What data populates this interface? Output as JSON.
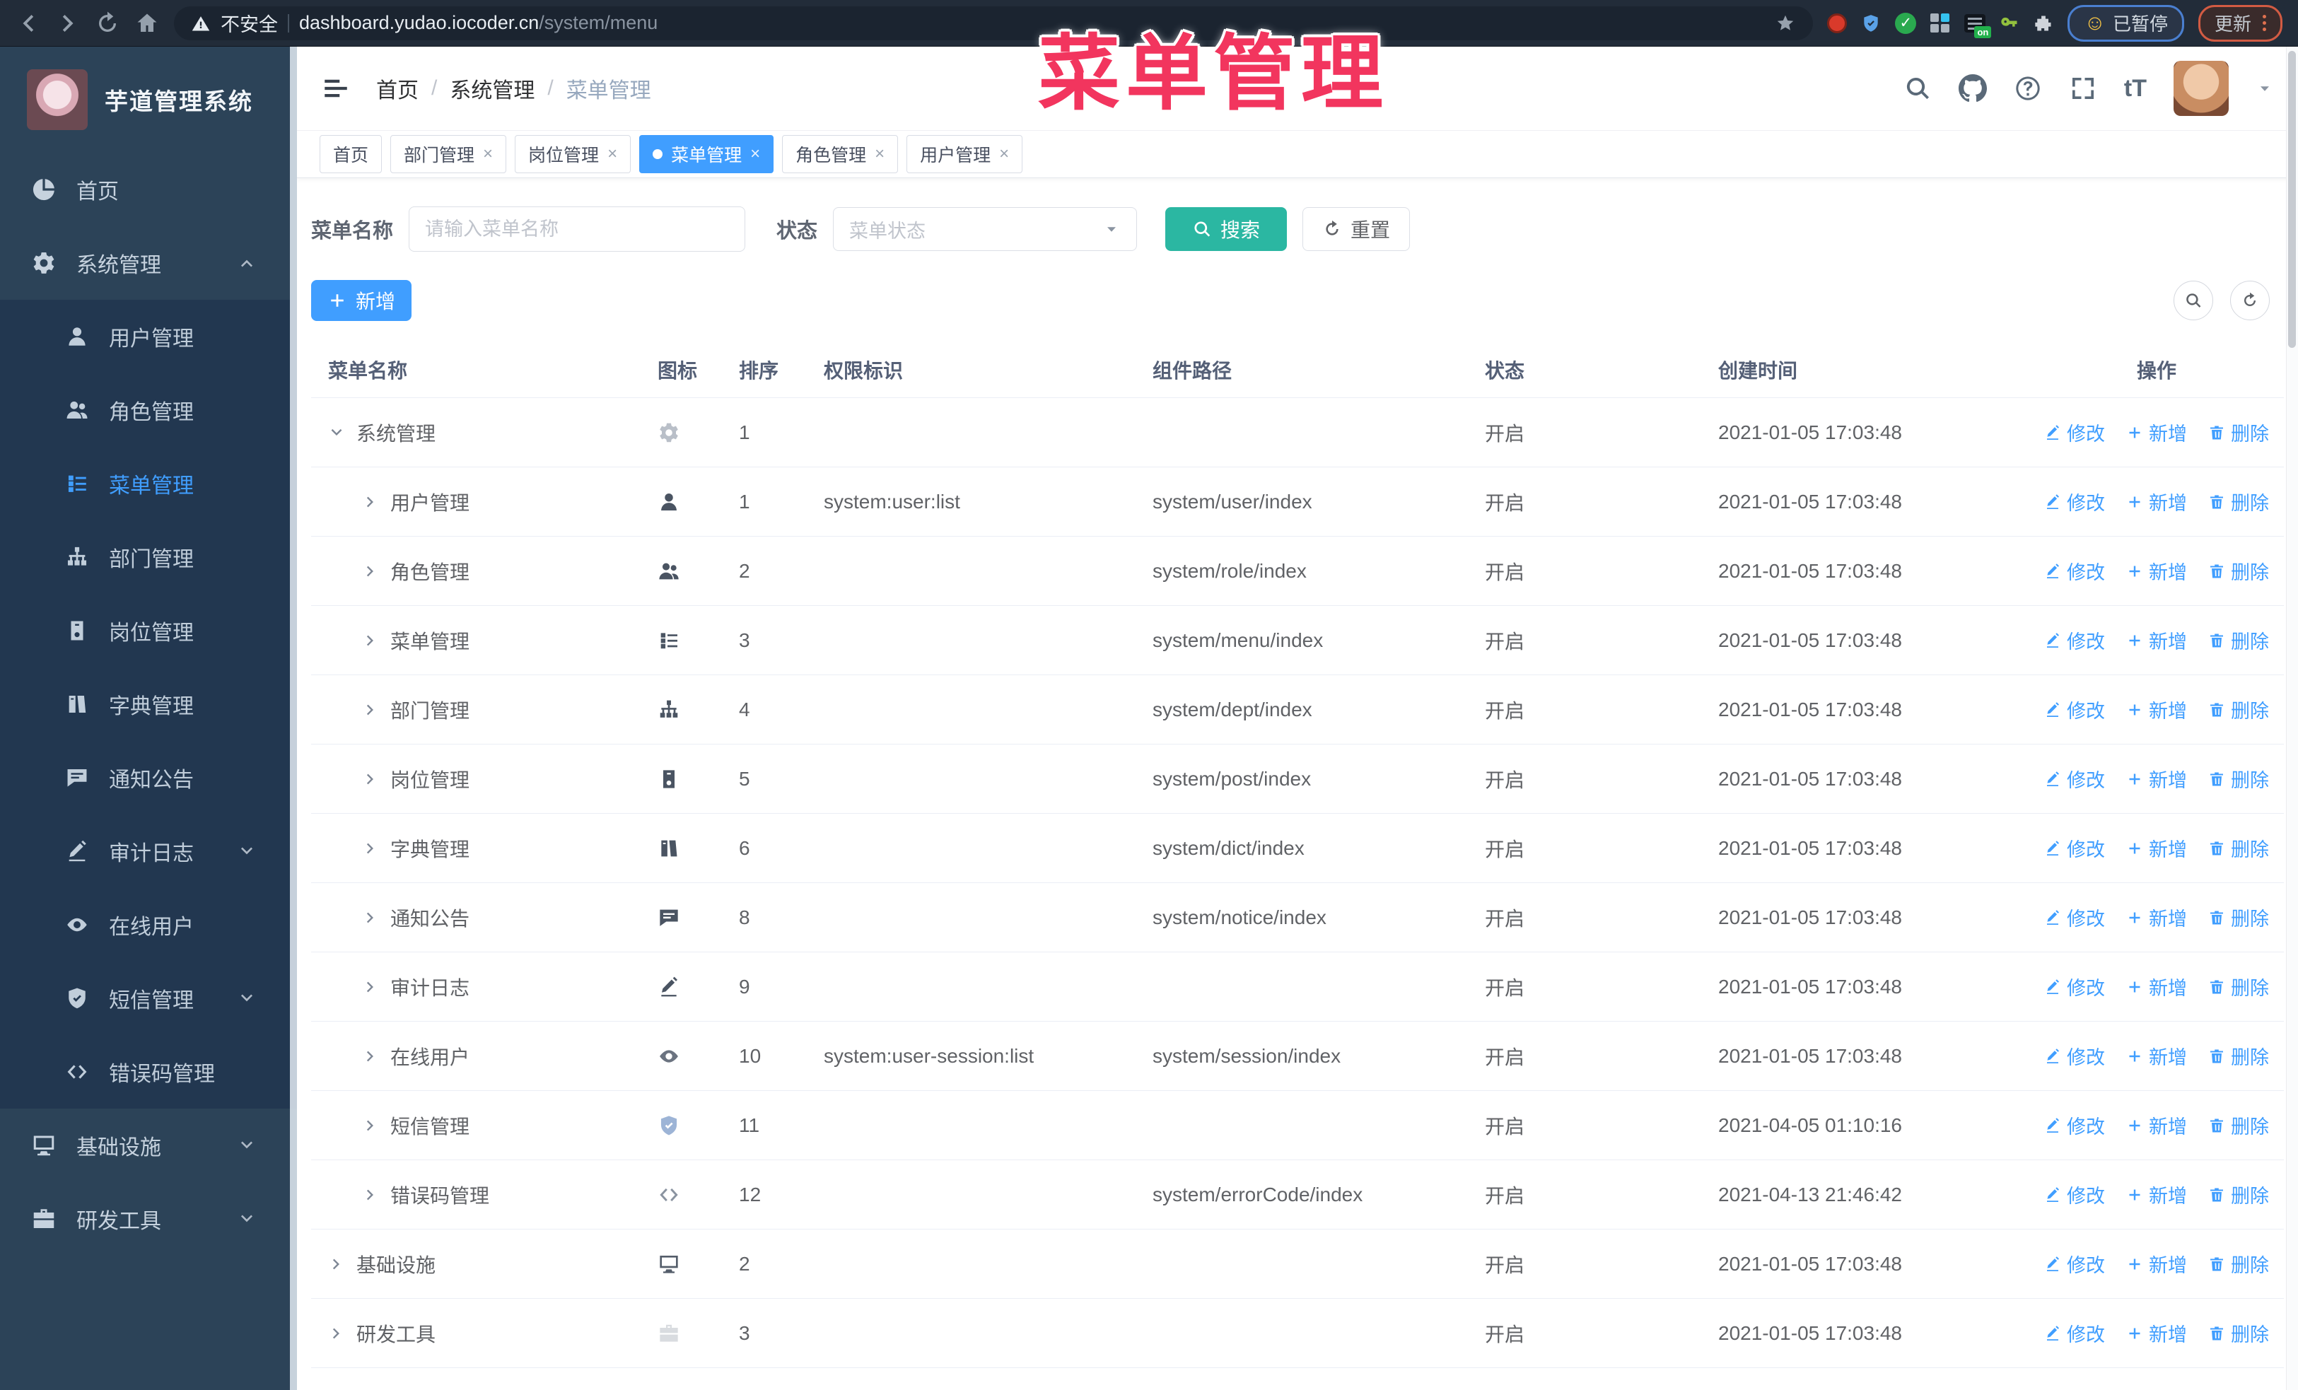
{
  "browser": {
    "security_label": "不安全",
    "url_host": "dashboard.yudao.iocoder.cn",
    "url_path": "/system/menu",
    "list_ext_badge": "on",
    "paused_label": "已暂停",
    "update_label": "更新"
  },
  "sidebar": {
    "title": "芋道管理系统",
    "menu": [
      {
        "label": "首页",
        "icon": "dashboard",
        "level": 0
      },
      {
        "label": "系统管理",
        "icon": "gear",
        "level": 0,
        "arrow": "up"
      },
      {
        "label": "用户管理",
        "icon": "user",
        "level": 1
      },
      {
        "label": "角色管理",
        "icon": "users",
        "level": 1
      },
      {
        "label": "菜单管理",
        "icon": "menutree",
        "level": 1,
        "active": true
      },
      {
        "label": "部门管理",
        "icon": "org",
        "level": 1
      },
      {
        "label": "岗位管理",
        "icon": "badge",
        "level": 1
      },
      {
        "label": "字典管理",
        "icon": "books",
        "level": 1
      },
      {
        "label": "通知公告",
        "icon": "notice",
        "level": 1
      },
      {
        "label": "审计日志",
        "icon": "audit",
        "level": 1,
        "arrow": "down"
      },
      {
        "label": "在线用户",
        "icon": "online",
        "level": 1
      },
      {
        "label": "短信管理",
        "icon": "shield",
        "level": 1,
        "arrow": "down"
      },
      {
        "label": "错误码管理",
        "icon": "code",
        "level": 1
      },
      {
        "label": "基础设施",
        "icon": "monitor",
        "level": 0,
        "arrow": "down"
      },
      {
        "label": "研发工具",
        "icon": "toolbox",
        "level": 0,
        "arrow": "down"
      }
    ]
  },
  "header": {
    "breadcrumb": [
      "首页",
      "系统管理",
      "菜单管理"
    ],
    "icons": [
      "search-icon",
      "github-icon",
      "question-icon",
      "fullscreen-icon",
      "font-size-icon",
      "avatar",
      "caret-down-icon"
    ]
  },
  "tabs": [
    {
      "label": "首页"
    },
    {
      "label": "部门管理",
      "closable": true
    },
    {
      "label": "岗位管理",
      "closable": true
    },
    {
      "label": "菜单管理",
      "closable": true,
      "active": true
    },
    {
      "label": "角色管理",
      "closable": true
    },
    {
      "label": "用户管理",
      "closable": true
    }
  ],
  "watermark": "菜单管理",
  "filter": {
    "name_label": "菜单名称",
    "name_placeholder": "请输入菜单名称",
    "name_value": "",
    "status_label": "状态",
    "status_placeholder": "菜单状态",
    "search_label": "搜索",
    "reset_label": "重置"
  },
  "toolbar": {
    "add_label": "新增"
  },
  "table": {
    "columns": [
      "菜单名称",
      "图标",
      "排序",
      "权限标识",
      "组件路径",
      "状态",
      "创建时间",
      "操作"
    ],
    "ops": {
      "edit": "修改",
      "add": "新增",
      "delete": "删除"
    },
    "rows": [
      {
        "name": "系统管理",
        "expand": "down",
        "level": 0,
        "icon": "gear",
        "icon_color": "#b9bfc8",
        "order": "1",
        "perm": "",
        "path": "",
        "status": "开启",
        "created": "2021-01-05 17:03:48"
      },
      {
        "name": "用户管理",
        "expand": "right",
        "level": 1,
        "icon": "user",
        "icon_color": "#4a5462",
        "order": "1",
        "perm": "system:user:list",
        "path": "system/user/index",
        "status": "开启",
        "created": "2021-01-05 17:03:48"
      },
      {
        "name": "角色管理",
        "expand": "right",
        "level": 1,
        "icon": "users",
        "icon_color": "#4a5462",
        "order": "2",
        "perm": "",
        "path": "system/role/index",
        "status": "开启",
        "created": "2021-01-05 17:03:48"
      },
      {
        "name": "菜单管理",
        "expand": "right",
        "level": 1,
        "icon": "menutree",
        "icon_color": "#4a5462",
        "order": "3",
        "perm": "",
        "path": "system/menu/index",
        "status": "开启",
        "created": "2021-01-05 17:03:48"
      },
      {
        "name": "部门管理",
        "expand": "right",
        "level": 1,
        "icon": "org",
        "icon_color": "#4a5462",
        "order": "4",
        "perm": "",
        "path": "system/dept/index",
        "status": "开启",
        "created": "2021-01-05 17:03:48"
      },
      {
        "name": "岗位管理",
        "expand": "right",
        "level": 1,
        "icon": "badge",
        "icon_color": "#4a5462",
        "order": "5",
        "perm": "",
        "path": "system/post/index",
        "status": "开启",
        "created": "2021-01-05 17:03:48"
      },
      {
        "name": "字典管理",
        "expand": "right",
        "level": 1,
        "icon": "books",
        "icon_color": "#4a5462",
        "order": "6",
        "perm": "",
        "path": "system/dict/index",
        "status": "开启",
        "created": "2021-01-05 17:03:48"
      },
      {
        "name": "通知公告",
        "expand": "right",
        "level": 1,
        "icon": "notice",
        "icon_color": "#4a5462",
        "order": "8",
        "perm": "",
        "path": "system/notice/index",
        "status": "开启",
        "created": "2021-01-05 17:03:48"
      },
      {
        "name": "审计日志",
        "expand": "right",
        "level": 1,
        "icon": "audit",
        "icon_color": "#4a5462",
        "order": "9",
        "perm": "",
        "path": "",
        "status": "开启",
        "created": "2021-01-05 17:03:48"
      },
      {
        "name": "在线用户",
        "expand": "right",
        "level": 1,
        "icon": "online",
        "icon_color": "#6b7380",
        "order": "10",
        "perm": "system:user-session:list",
        "path": "system/session/index",
        "status": "开启",
        "created": "2021-01-05 17:03:48"
      },
      {
        "name": "短信管理",
        "expand": "right",
        "level": 1,
        "icon": "shield",
        "icon_color": "#9db4d6",
        "order": "11",
        "perm": "",
        "path": "",
        "status": "开启",
        "created": "2021-04-05 01:10:16"
      },
      {
        "name": "错误码管理",
        "expand": "right",
        "level": 1,
        "icon": "code",
        "icon_color": "#8a93a0",
        "order": "12",
        "perm": "",
        "path": "system/errorCode/index",
        "status": "开启",
        "created": "2021-04-13 21:46:42"
      },
      {
        "name": "基础设施",
        "expand": "right",
        "level": 0,
        "icon": "monitor",
        "icon_color": "#545d6a",
        "order": "2",
        "perm": "",
        "path": "",
        "status": "开启",
        "created": "2021-01-05 17:03:48"
      },
      {
        "name": "研发工具",
        "expand": "right",
        "level": 0,
        "icon": "toolbox",
        "icon_color": "#d9dce0",
        "order": "3",
        "perm": "",
        "path": "",
        "status": "开启",
        "created": "2021-01-05 17:03:48"
      }
    ]
  },
  "colors": {
    "primary": "#409eff",
    "search_teal": "#2bb7a2",
    "annotation_pink": "#f2355e",
    "sidebar_bg": "#2c4358",
    "submenu_bg": "#223750"
  }
}
